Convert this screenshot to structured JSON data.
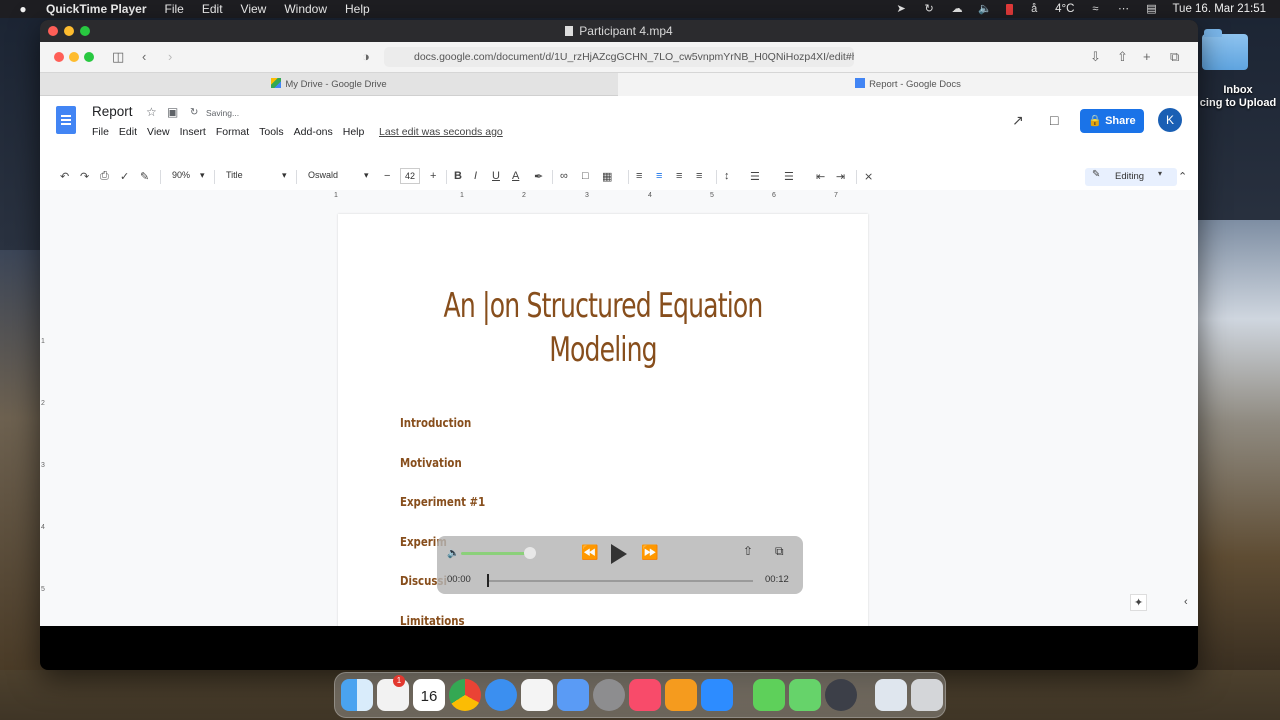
{
  "menubar": {
    "apple_icon": "apple-icon",
    "app_name": "QuickTime Player",
    "items": [
      "File",
      "Edit",
      "View",
      "Window",
      "Help"
    ],
    "temperature": "4°C",
    "datetime": "Tue 16. Mar  21:51"
  },
  "desktop": {
    "folder_label_1": "Inbox",
    "folder_label_2": "cing to Upload"
  },
  "qt_window": {
    "title": "Participant 4.mp4"
  },
  "safari": {
    "url": "docs.google.com/document/d/1U_rzHjAZcgGCHN_7LO_cw5vnpmYrNB_H0QNiHozp4XI/edit#h",
    "tabs": [
      {
        "label": "My Drive - Google Drive"
      },
      {
        "label": "Report - Google Docs"
      }
    ]
  },
  "docs": {
    "doc_title": "Report",
    "saving_status": "Saving...",
    "menu": [
      "File",
      "Edit",
      "View",
      "Insert",
      "Format",
      "Tools",
      "Add-ons",
      "Help"
    ],
    "last_edit": "Last edit was seconds ago",
    "share_label": "Share",
    "avatar_letter": "K",
    "toolbar": {
      "zoom": "90%",
      "style": "Title",
      "font": "Oswald",
      "font_size": "42",
      "mode": "Editing"
    },
    "ruler_marks": [
      "1",
      "1",
      "2",
      "3",
      "4",
      "5",
      "6",
      "7"
    ],
    "vruler_marks": [
      "1",
      "2",
      "3",
      "4",
      "5"
    ],
    "title_line1": "An |on Structured Equation",
    "title_line2": "Modeling",
    "toc": [
      "Introduction",
      "Motivation",
      "Experiment #1",
      "Experim",
      "Discussi",
      "Limitations"
    ]
  },
  "player": {
    "current_time": "00:00",
    "duration": "00:12",
    "progress": 0.0,
    "volume": 0.8
  },
  "dock": {
    "calendar_day": "16",
    "calendar_month": "MAR",
    "reminder_badge": "1",
    "apps": [
      "finder-icon",
      "reminders-icon",
      "calendar-icon",
      "chrome-icon",
      "safari-icon",
      "tv-icon",
      "feather-icon",
      "system-preferences-icon",
      "music-icon",
      "sheets-icon",
      "zoom-icon",
      "facetime-icon",
      "messages-icon",
      "quicktime-icon",
      "preview-icon",
      "trash-icon"
    ]
  },
  "colors": {
    "doc_heading": "#874e1c",
    "share_blue": "#1a73e8",
    "volume_green": "#8bd07a"
  }
}
